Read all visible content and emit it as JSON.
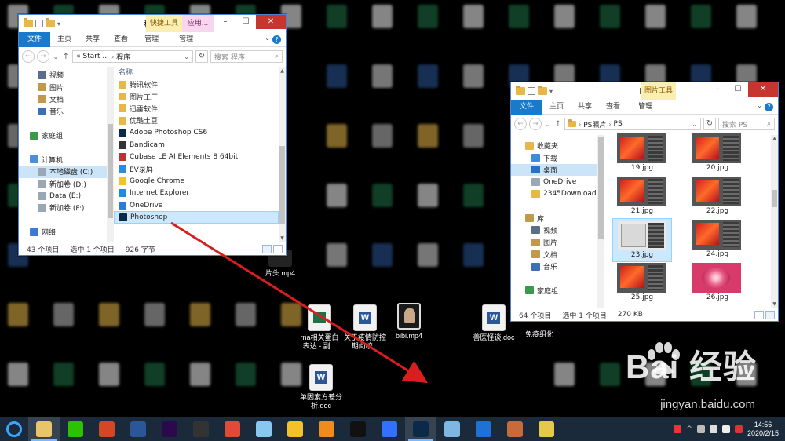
{
  "colors": {
    "accent": "#1979ca",
    "selection": "#cce8ff",
    "close_red": "#c7362e",
    "folder": "#e8b74a",
    "arrow": "#d81e1e",
    "taskbar": "#1b2a3a"
  },
  "desktop": {
    "icons": [
      {
        "label": "rna相关蛋白表达 - 副...",
        "icon": "excel-doc-icon"
      },
      {
        "label": "关于疫情防控期间校...",
        "icon": "word-doc-icon"
      },
      {
        "label": "bibi.mp4",
        "icon": "video-file-icon"
      },
      {
        "label": "善医怪谈.doc",
        "icon": "word-doc-icon"
      },
      {
        "label": "免疫组化",
        "icon": "folder-icon"
      },
      {
        "label": "单因素方差分析.doc",
        "icon": "word-doc-icon"
      },
      {
        "label": "片头.mp4",
        "icon": "video-file-icon"
      }
    ]
  },
  "win_programs": {
    "title": "程序",
    "context_tabs": [
      "快捷工具",
      "应用..."
    ],
    "ribbon_tabs": [
      "文件",
      "主页",
      "共享",
      "查看",
      "管理",
      "管理"
    ],
    "address": [
      "«",
      "Start ...",
      "程序"
    ],
    "search_placeholder": "搜索 程序",
    "nav": [
      {
        "label": "视频",
        "icon": "video-library-icon"
      },
      {
        "label": "图片",
        "icon": "pictures-library-icon"
      },
      {
        "label": "文档",
        "icon": "documents-library-icon"
      },
      {
        "label": "音乐",
        "icon": "music-library-icon"
      },
      {
        "label": "",
        "icon": ""
      },
      {
        "label": "家庭组",
        "icon": "homegroup-icon"
      },
      {
        "label": "",
        "icon": ""
      },
      {
        "label": "计算机",
        "icon": "computer-icon"
      },
      {
        "label": "本地磁盘 (C:)",
        "icon": "drive-c-icon"
      },
      {
        "label": "新加卷 (D:)",
        "icon": "drive-icon"
      },
      {
        "label": "Data (E:)",
        "icon": "drive-icon"
      },
      {
        "label": "新加卷 (F:)",
        "icon": "drive-icon"
      },
      {
        "label": "",
        "icon": ""
      },
      {
        "label": "网络",
        "icon": "network-icon"
      }
    ],
    "column_name": "名称",
    "files": [
      {
        "name": "腾讯软件",
        "icon": "folder-icon"
      },
      {
        "name": "图片工厂",
        "icon": "folder-icon"
      },
      {
        "name": "迅雷软件",
        "icon": "folder-icon"
      },
      {
        "name": "优酷土豆",
        "icon": "folder-icon"
      },
      {
        "name": "Adobe Photoshop CS6",
        "icon": "photoshop-shortcut-icon"
      },
      {
        "name": "Bandicam",
        "icon": "bandicam-icon"
      },
      {
        "name": "Cubase LE AI Elements 8 64bit",
        "icon": "cubase-icon"
      },
      {
        "name": "EV录屏",
        "icon": "ev-recorder-icon"
      },
      {
        "name": "Google Chrome",
        "icon": "chrome-icon"
      },
      {
        "name": "Internet Explorer",
        "icon": "ie-icon"
      },
      {
        "name": "OneDrive",
        "icon": "onedrive-icon"
      },
      {
        "name": "Photoshop",
        "icon": "photoshop-shortcut-icon"
      }
    ],
    "status": {
      "count": "43 个项目",
      "selected": "选中 1 个项目",
      "size": "926 字节"
    }
  },
  "win_ps": {
    "title": "PS",
    "context_tab": "图片工具",
    "ribbon_tabs": [
      "文件",
      "主页",
      "共享",
      "查看",
      "管理"
    ],
    "address": [
      "PS照片",
      "PS"
    ],
    "search_placeholder": "搜索 PS",
    "nav": [
      {
        "label": "收藏夹",
        "icon": "favorites-star-icon"
      },
      {
        "label": "下载",
        "icon": "downloads-icon"
      },
      {
        "label": "桌面",
        "icon": "desktop-icon"
      },
      {
        "label": "OneDrive",
        "icon": "onedrive-icon"
      },
      {
        "label": "2345Downloads",
        "icon": "folder-icon"
      },
      {
        "label": "",
        "icon": ""
      },
      {
        "label": "库",
        "icon": "libraries-icon"
      },
      {
        "label": "视频",
        "icon": "video-library-icon"
      },
      {
        "label": "图片",
        "icon": "pictures-library-icon"
      },
      {
        "label": "文档",
        "icon": "documents-library-icon"
      },
      {
        "label": "音乐",
        "icon": "music-library-icon"
      },
      {
        "label": "",
        "icon": ""
      },
      {
        "label": "家庭组",
        "icon": "homegroup-icon"
      }
    ],
    "thumbs": [
      {
        "label": "19.jpg",
        "style": "ps"
      },
      {
        "label": "20.jpg",
        "style": "ps"
      },
      {
        "label": "21.jpg",
        "style": "ps"
      },
      {
        "label": "22.jpg",
        "style": "ps"
      },
      {
        "label": "23.jpg",
        "style": "light"
      },
      {
        "label": "24.jpg",
        "style": "ps"
      },
      {
        "label": "25.jpg",
        "style": "ps"
      },
      {
        "label": "26.jpg",
        "style": "rose"
      }
    ],
    "status": {
      "count": "64 个项目",
      "selected": "选中 1 个项目",
      "size": "270 KB"
    }
  },
  "taskbar": {
    "apps": [
      {
        "name": "file-explorer-icon",
        "color": "#e8c46a"
      },
      {
        "name": "wechat-icon",
        "color": "#2dc100"
      },
      {
        "name": "powerpoint-icon",
        "color": "#d24726"
      },
      {
        "name": "word-icon",
        "color": "#2b5797"
      },
      {
        "name": "premiere-icon",
        "color": "#2a0a4a"
      },
      {
        "name": "video-editor-icon",
        "color": "#333333"
      },
      {
        "name": "image-viewer-icon",
        "color": "#e04a3a"
      },
      {
        "name": "bird-app-icon",
        "color": "#8ac7f0"
      },
      {
        "name": "chrome-icon",
        "color": "#f3c12a"
      },
      {
        "name": "firefox-icon",
        "color": "#f08b1e"
      },
      {
        "name": "qq-icon",
        "color": "#111111"
      },
      {
        "name": "feishu-icon",
        "color": "#3370ff"
      },
      {
        "name": "photoshop-icon",
        "color": "#0b2a4a"
      },
      {
        "name": "notes-icon",
        "color": "#7fb7e3"
      },
      {
        "name": "wps-icon",
        "color": "#1e72d6"
      },
      {
        "name": "mascot-app-icon",
        "color": "#c96a3a"
      },
      {
        "name": "notepad-app-icon",
        "color": "#e6c84a"
      }
    ],
    "time": "14:56",
    "date": "2020/2/15"
  },
  "watermark": {
    "brand": "Bai 经验",
    "url": "jingyan.baidu.com"
  }
}
